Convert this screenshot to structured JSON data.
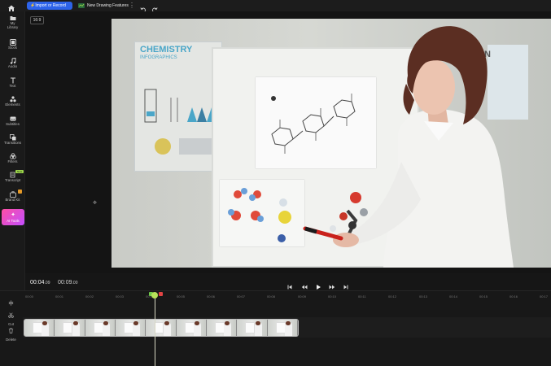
{
  "topbar": {
    "import_label": "Import or Record",
    "new_drawing_label": "New Drawing Features",
    "more_label": "⋮",
    "accent_color": "#2d63e9"
  },
  "sidebar": {
    "items": [
      {
        "line1": "My",
        "line2": "Library",
        "icon": "folder-icon"
      },
      {
        "line1": "Stock",
        "icon": "stock-icon"
      },
      {
        "line1": "Audio",
        "icon": "music-note-icon"
      },
      {
        "line1": "Text",
        "icon": "text-icon"
      },
      {
        "line1": "Elements",
        "icon": "shapes-icon"
      },
      {
        "line1": "Subtitles",
        "icon": "subtitles-icon"
      },
      {
        "line1": "Transitions",
        "icon": "transitions-icon"
      },
      {
        "line1": "Filters",
        "icon": "filters-icon"
      },
      {
        "line1": "Transcript",
        "icon": "transcript-icon",
        "badge": "New"
      },
      {
        "line1": "Brand Kit",
        "icon": "brand-kit-icon"
      }
    ],
    "ai_tools_label": "AI Tools",
    "ai_tools_icon": "sparkle-icon"
  },
  "canvas": {
    "aspect_ratio": "16:9",
    "poster_title": "CHEMISTRY",
    "poster_subtitle": "INFOGRAPHICS",
    "right_poster_text": "N"
  },
  "playback": {
    "current_time": "00:04",
    "current_ms": ".09",
    "total_time": "00:09",
    "total_ms": ".00"
  },
  "timeline": {
    "tools": [
      {
        "label": "",
        "icon": "split-icon"
      },
      {
        "label": "Cut",
        "icon": "scissors-icon"
      },
      {
        "label": "Delete",
        "icon": "trash-icon"
      }
    ],
    "ruler_labels": [
      "00:00",
      "00:01",
      "00:02",
      "00:03",
      "00:04",
      "00:05",
      "00:06",
      "00:07",
      "00:08",
      "00:09",
      "00:10",
      "00:11",
      "00:12",
      "00:13",
      "00:14",
      "00:15",
      "00:16",
      "00:17"
    ],
    "clip_thumbnail_count": 9
  }
}
